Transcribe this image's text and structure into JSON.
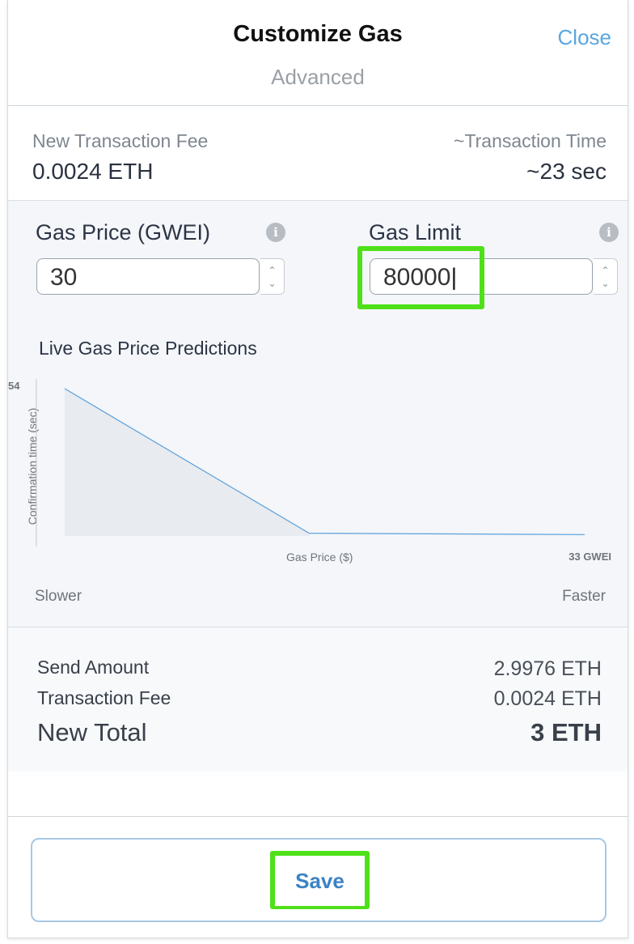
{
  "header": {
    "title": "Customize Gas",
    "subtitle": "Advanced",
    "close_label": "Close"
  },
  "summary": {
    "fee_label": "New Transaction Fee",
    "fee_value": "0.0024 ETH",
    "time_label": "~Transaction Time",
    "time_value": "~23 sec"
  },
  "gas_price": {
    "label": "Gas Price (GWEI)",
    "value": "30",
    "info_icon": "info-icon"
  },
  "gas_limit": {
    "label": "Gas Limit",
    "value": "80000",
    "info_icon": "info-icon"
  },
  "chart": {
    "title": "Live Gas Price Predictions",
    "y_tick": "54",
    "y_label": "Confirmation time (sec)",
    "x_label": "Gas Price ($)",
    "x_tick": "33 GWEI",
    "left_label": "Slower",
    "right_label": "Faster"
  },
  "chart_data": {
    "type": "area",
    "title": "Live Gas Price Predictions",
    "xlabel": "Gas Price ($)",
    "ylabel": "Confirmation time (sec)",
    "x_max_label": "33 GWEI",
    "y_max": 54,
    "series": [
      {
        "x": [
          0,
          0.47,
          1.0
        ],
        "y": [
          54,
          1,
          0.5
        ]
      }
    ],
    "fill_color": "#e8ebef",
    "line_color": "#5b9fdb"
  },
  "totals": {
    "send_label": "Send Amount",
    "send_value": "2.9976 ETH",
    "fee_label": "Transaction Fee",
    "fee_value": "0.0024 ETH",
    "total_label": "New Total",
    "total_value": "3 ETH"
  },
  "footer": {
    "save_label": "Save"
  },
  "colors": {
    "accent": "#5aa6e0",
    "button_text": "#3b82c4",
    "highlight": "#4fe01a"
  }
}
